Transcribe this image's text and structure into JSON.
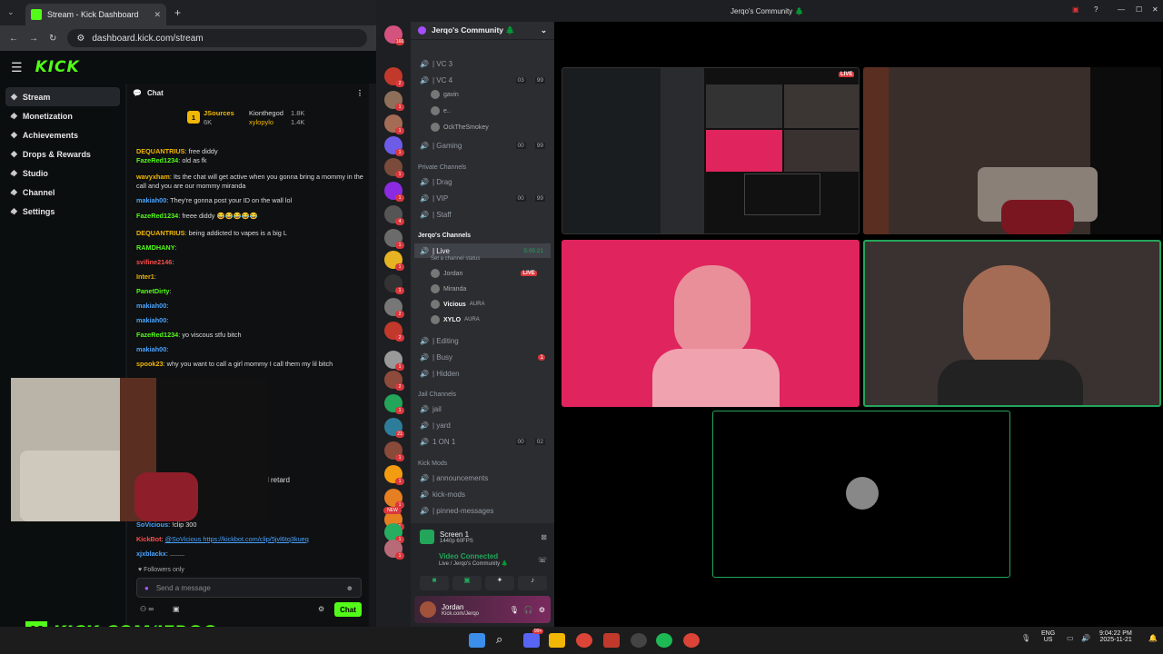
{
  "browser": {
    "tab_title": "Stream - Kick Dashboard",
    "url": "dashboard.kick.com/stream",
    "new_tab": "+"
  },
  "kick": {
    "logo": "KICK",
    "nav": [
      {
        "label": "Stream",
        "icon": "stream-icon",
        "active": true
      },
      {
        "label": "Monetization",
        "icon": "dollar-icon",
        "chevron": true
      },
      {
        "label": "Achievements",
        "icon": "trophy-icon"
      },
      {
        "label": "Drops & Rewards",
        "icon": "gift-icon"
      },
      {
        "label": "Studio",
        "icon": "studio-icon",
        "chevron": true
      },
      {
        "label": "Channel",
        "icon": "channel-icon",
        "chevron": true
      },
      {
        "label": "Settings",
        "icon": "gear-icon",
        "chevron": true
      }
    ]
  },
  "chat": {
    "title": "Chat",
    "gifters": [
      {
        "rank": "1",
        "name": "JSources",
        "count": "6K"
      },
      {
        "name": "Kionthegod",
        "count": "1.8K"
      },
      {
        "name": "xylopylo",
        "count": "1.4K"
      }
    ],
    "messages": [
      {
        "user": "DEQUANTRIUS",
        "color": "#f2b705",
        "text": "free diddy"
      },
      {
        "user": "FazeRed1234",
        "color": "#53fc18",
        "text": "old as fk"
      },
      {
        "user": "wavyxham",
        "color": "#f2b705",
        "text": "Its the chat will get active when you gonna bring a mommy in the call and you are our mommy miranda"
      },
      {
        "user": "makiah00",
        "color": "#4aa3ff",
        "text": "They're gonna post your ID on the wall lol"
      },
      {
        "user": "FazeRed1234",
        "color": "#53fc18",
        "text": "freee diddy 😂😂😂😂😂"
      },
      {
        "user": "DEQUANTRIUS",
        "color": "#f2b705",
        "text": "being addicted to vapes is a big L"
      },
      {
        "user": "RAMDHANY",
        "color": "#53fc18",
        "text": ""
      },
      {
        "user": "svifine2146",
        "color": "#ff4d4d",
        "text": ""
      },
      {
        "user": "Inter1",
        "color": "#f2b705",
        "text": ""
      },
      {
        "user": "PanetDirty",
        "color": "#53fc18",
        "text": ""
      },
      {
        "user": "makiah00",
        "color": "#4aa3ff",
        "text": ""
      },
      {
        "user": "makiah00",
        "color": "#4aa3ff",
        "text": ""
      },
      {
        "user": "FazeRed1234",
        "color": "#53fc18",
        "text": "yo viscous stfu bitch"
      },
      {
        "user": "makiah00",
        "color": "#4aa3ff",
        "text": ""
      },
      {
        "user": "spook23",
        "color": "#f2b705",
        "text": "why you want to call a girl mommy I call them my lil bitch"
      }
    ],
    "partial_text": "l retard",
    "bottom_messages": [
      {
        "user": "SoVicious",
        "color": "#4aa3ff",
        "text": "!clip 300"
      },
      {
        "user": "KickBot",
        "color": "#ff4d4d",
        "text": "@SoVicious https://kickbot.com/clip/5jvl6tq3kueq"
      },
      {
        "user": "xjxblackx",
        "color": "#4aa3ff",
        "text": "........"
      }
    ],
    "followers_only": "Followers only",
    "placeholder": "Send a message",
    "send_label": "Chat"
  },
  "discord": {
    "window_title": "Jerqo's Community 🌲",
    "server_name": "Jerqo's Community 🌲",
    "guild_badges": [
      "166",
      "2",
      "1",
      "1",
      "1",
      "1",
      "1",
      "4",
      "1",
      "1",
      "1",
      "2",
      "2",
      "1",
      "2",
      "1",
      "21",
      "1",
      "1",
      "1",
      "1",
      "1",
      "1"
    ],
    "new_label": "NEW",
    "channels_top": [
      {
        "name": "| VC 3"
      },
      {
        "name": "| VC 4",
        "c1": "03",
        "c2": "99"
      }
    ],
    "vc4_users": [
      "gavin",
      "e..",
      "OckTheSmokey"
    ],
    "gaming": {
      "name": "| Gaming",
      "c1": "00",
      "c2": "99"
    },
    "private_cat": "Private Channels",
    "private": [
      {
        "name": "| Drag"
      },
      {
        "name": "| VIP",
        "c1": "00",
        "c2": "99"
      },
      {
        "name": "| Staff"
      }
    ],
    "jerqo_cat": "Jerqo's Channels",
    "live_channel": {
      "name": "| Live",
      "timer": "5:05:21",
      "status": "Set a channel status"
    },
    "live_users": [
      {
        "name": "Jordan",
        "live": "LIVE"
      },
      {
        "name": "Miranda"
      },
      {
        "name": "Vicious",
        "tag": "AURA"
      },
      {
        "name": "XYLO",
        "tag": "AURA"
      }
    ],
    "jerqo_more": [
      {
        "name": "| Editing"
      },
      {
        "name": "| Busy",
        "badge": "1"
      },
      {
        "name": "| Hidden"
      }
    ],
    "jail_cat": "Jail Channels",
    "jail": [
      {
        "name": "jail"
      },
      {
        "name": "| yard"
      },
      {
        "name": "1 ON 1",
        "c1": "00",
        "c2": "02"
      }
    ],
    "mods_cat": "Kick Mods",
    "mods": [
      {
        "name": "| announcements"
      },
      {
        "name": "kick-mods"
      },
      {
        "name": "| pinned-messages"
      }
    ],
    "screen": {
      "title": "Screen 1",
      "sub": "1440p 60FPS"
    },
    "voice": {
      "status": "Video Connected",
      "sub": "Live / Jerqo's Community 🌲"
    },
    "user": {
      "name": "Jordan",
      "sub": "Kick.com/Jerqo"
    },
    "share_live": "LIVE"
  },
  "overlay": {
    "brand": "KICK.COM/JERQO",
    "k": "K"
  },
  "taskbar": {
    "lang1": "ENG",
    "lang2": "US",
    "time": "9:04:22 PM",
    "date": "2025-11-21",
    "discord_badge": "99+"
  },
  "colors": {
    "kick_green": "#53fc18",
    "discord_bg": "#2b2d31",
    "live_red": "#da373c",
    "pink_tile": "#e0245e"
  }
}
